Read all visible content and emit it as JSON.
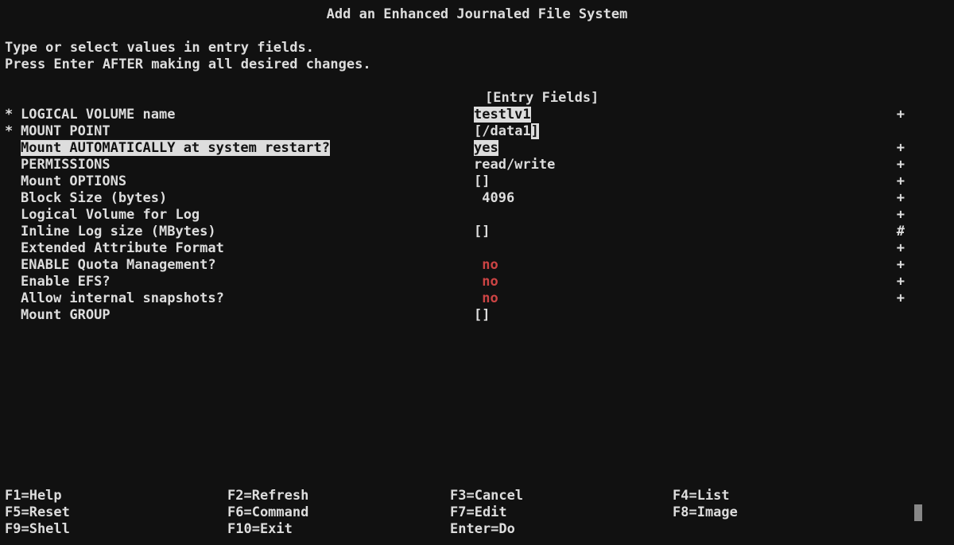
{
  "title": "Add an Enhanced Journaled File System",
  "instructions": {
    "line1": "Type or select values in entry fields.",
    "line2": "Press Enter AFTER making all desired changes."
  },
  "entry_fields_header": "[Entry Fields]",
  "rows": [
    {
      "marker": "*",
      "label": "LOGICAL VOLUME name",
      "value": "testlv1",
      "flag": "+",
      "labelHl": false,
      "valueHl": true,
      "valueRed": false,
      "bracket": false
    },
    {
      "marker": "*",
      "label": "MOUNT POINT",
      "value": "/data1",
      "flag": "",
      "labelHl": false,
      "valueHl": false,
      "valueRed": false,
      "bracket": true,
      "closeHl": true
    },
    {
      "marker": "",
      "label": "Mount AUTOMATICALLY at system restart?",
      "value": "yes",
      "flag": "+",
      "labelHl": true,
      "valueHl": true,
      "valueRed": false,
      "bracket": false
    },
    {
      "marker": "",
      "label": "PERMISSIONS",
      "value": "read/write",
      "flag": "+",
      "labelHl": false,
      "valueHl": false,
      "valueRed": false,
      "bracket": false
    },
    {
      "marker": "",
      "label": "Mount OPTIONS",
      "value": "",
      "flag": "+",
      "labelHl": false,
      "valueHl": false,
      "valueRed": false,
      "bracket": true
    },
    {
      "marker": "",
      "label": "Block Size (bytes)",
      "value": " 4096",
      "flag": "+",
      "labelHl": false,
      "valueHl": false,
      "valueRed": false,
      "bracket": false
    },
    {
      "marker": "",
      "label": "Logical Volume for Log",
      "value": "",
      "flag": "+",
      "labelHl": false,
      "valueHl": false,
      "valueRed": false,
      "bracket": false
    },
    {
      "marker": "",
      "label": "Inline Log size (MBytes)",
      "value": "",
      "flag": "#",
      "labelHl": false,
      "valueHl": false,
      "valueRed": false,
      "bracket": true
    },
    {
      "marker": "",
      "label": "Extended Attribute Format",
      "value": "",
      "flag": "+",
      "labelHl": false,
      "valueHl": false,
      "valueRed": false,
      "bracket": false
    },
    {
      "marker": "",
      "label": "ENABLE Quota Management?",
      "value": " no",
      "flag": "+",
      "labelHl": false,
      "valueHl": false,
      "valueRed": true,
      "bracket": false
    },
    {
      "marker": "",
      "label": "Enable EFS?",
      "value": " no",
      "flag": "+",
      "labelHl": false,
      "valueHl": false,
      "valueRed": true,
      "bracket": false
    },
    {
      "marker": "",
      "label": "Allow internal snapshots?",
      "value": " no",
      "flag": "+",
      "labelHl": false,
      "valueHl": false,
      "valueRed": true,
      "bracket": false
    },
    {
      "marker": "",
      "label": "Mount GROUP",
      "value": "",
      "flag": "",
      "labelHl": false,
      "valueHl": false,
      "valueRed": false,
      "bracket": true
    }
  ],
  "fnkeys": [
    [
      "F1=Help",
      "F2=Refresh",
      "F3=Cancel",
      "F4=List"
    ],
    [
      "F5=Reset",
      "F6=Command",
      "F7=Edit",
      "F8=Image"
    ],
    [
      "F9=Shell",
      "F10=Exit",
      "Enter=Do",
      ""
    ]
  ]
}
